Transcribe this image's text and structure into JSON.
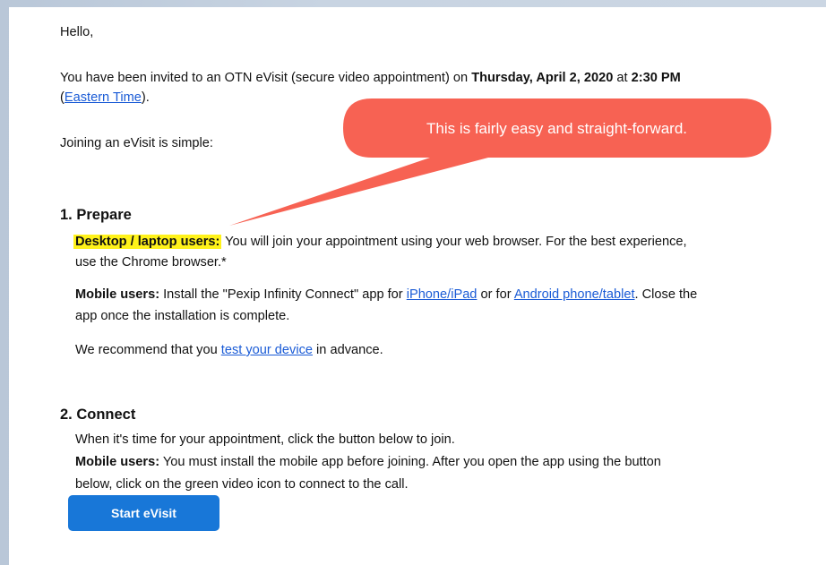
{
  "email": {
    "greeting": "Hello,",
    "invite_pre": "You have been invited to an OTN eVisit (secure video appointment) on ",
    "invite_date": "Thursday, April 2, 2020",
    "invite_at": " at ",
    "invite_time": "2:30 PM",
    "tz_open": "(",
    "tz_link": "Eastern Time",
    "tz_close": ").",
    "joining": "Joining an eVisit is simple:",
    "step1": {
      "heading": "1. Prepare",
      "desktop_label": "Desktop / laptop users:",
      "desktop_text_1": " You will join your appointment using your web browser. For the best experience,",
      "desktop_text_2": "use the Chrome browser.*",
      "mobile_label": "Mobile users:",
      "mobile_text_1": " Install the \"Pexip Infinity Connect\" app for ",
      "iphone_link": "iPhone/iPad",
      "mobile_or": " or for ",
      "android_link": "Android phone/tablet",
      "mobile_text_2": ". Close the",
      "mobile_text_3": "app once the installation is complete.",
      "recommend_pre": "We recommend that you ",
      "test_link": "test your device",
      "recommend_post": " in advance."
    },
    "step2": {
      "heading": "2. Connect",
      "when_text": "When it's time for your appointment, click the button below to join.",
      "mobile_label": "Mobile users:",
      "mobile_text_1": " You must install the mobile app before joining. After you open the app using the button",
      "mobile_text_2": "below, click on the green video icon to connect to the call.",
      "button_label": "Start eVisit"
    }
  },
  "annotation": {
    "callout_text": "This is fairly easy and straight-forward.",
    "callout_color": "#f75a4a",
    "highlight_color": "#fff21a"
  }
}
